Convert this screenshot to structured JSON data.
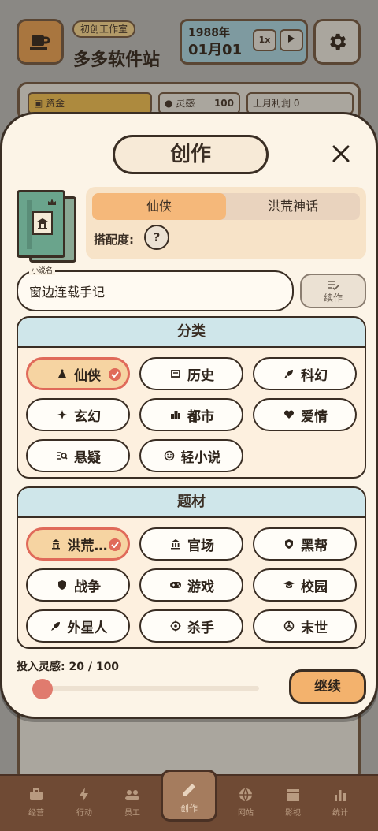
{
  "header": {
    "studio_tag": "初创工作室",
    "studio_name": "多多软件站",
    "year": "1988年",
    "date": "01月01",
    "speed": "1x"
  },
  "stats": {
    "money_label": "资金",
    "inspiration_label": "灵感",
    "inspiration_value": "100",
    "profit_label": "上月利润 0"
  },
  "modal": {
    "title": "创作",
    "genre_tabs": [
      {
        "label": "仙侠",
        "active": true
      },
      {
        "label": "洪荒神话",
        "active": false
      }
    ],
    "match_label": "搭配度:",
    "match_value": "?",
    "name_caption": "小说名",
    "name_value": "窗边连载手记",
    "sequel_label": "续作",
    "category_title": "分类",
    "categories": [
      {
        "label": "仙侠",
        "icon": "temple-icon",
        "selected": true
      },
      {
        "label": "历史",
        "icon": "scroll-icon",
        "selected": false
      },
      {
        "label": "科幻",
        "icon": "rocket-icon",
        "selected": false
      },
      {
        "label": "玄幻",
        "icon": "sparkle-icon",
        "selected": false
      },
      {
        "label": "都市",
        "icon": "city-icon",
        "selected": false
      },
      {
        "label": "爱情",
        "icon": "heart-icon",
        "selected": false
      },
      {
        "label": "悬疑",
        "icon": "search-list-icon",
        "selected": false
      },
      {
        "label": "轻小说",
        "icon": "smile-icon",
        "selected": false
      }
    ],
    "theme_title": "题材",
    "themes": [
      {
        "label": "洪荒…",
        "icon": "pagoda-icon",
        "selected": true
      },
      {
        "label": "官场",
        "icon": "government-icon",
        "selected": false
      },
      {
        "label": "黑帮",
        "icon": "badge-icon",
        "selected": false
      },
      {
        "label": "战争",
        "icon": "shield-icon",
        "selected": false
      },
      {
        "label": "游戏",
        "icon": "gamepad-icon",
        "selected": false
      },
      {
        "label": "校园",
        "icon": "graduation-cap-icon",
        "selected": false
      },
      {
        "label": "外星人",
        "icon": "rocket-icon",
        "selected": false
      },
      {
        "label": "杀手",
        "icon": "crosshair-icon",
        "selected": false
      },
      {
        "label": "末世",
        "icon": "radioactive-icon",
        "selected": false
      }
    ],
    "inspiration_label": "投入灵感:",
    "inspiration_value": "20 / 100",
    "inspiration_fraction": 0.2,
    "continue_label": "继续"
  },
  "nav": [
    {
      "label": "经营",
      "icon": "briefcase-icon"
    },
    {
      "label": "行动",
      "icon": "bolt-icon"
    },
    {
      "label": "员工",
      "icon": "people-icon"
    },
    {
      "label": "创作",
      "icon": "pen-icon",
      "active": true
    },
    {
      "label": "网站",
      "icon": "globe-icon"
    },
    {
      "label": "影视",
      "icon": "clapper-icon"
    },
    {
      "label": "统计",
      "icon": "bar-chart-icon"
    }
  ],
  "colors": {
    "accent": "#f3b26d",
    "selected_border": "#e06a5a",
    "section_header": "#cfe6ea",
    "modal_bg": "#fcf4e7"
  }
}
